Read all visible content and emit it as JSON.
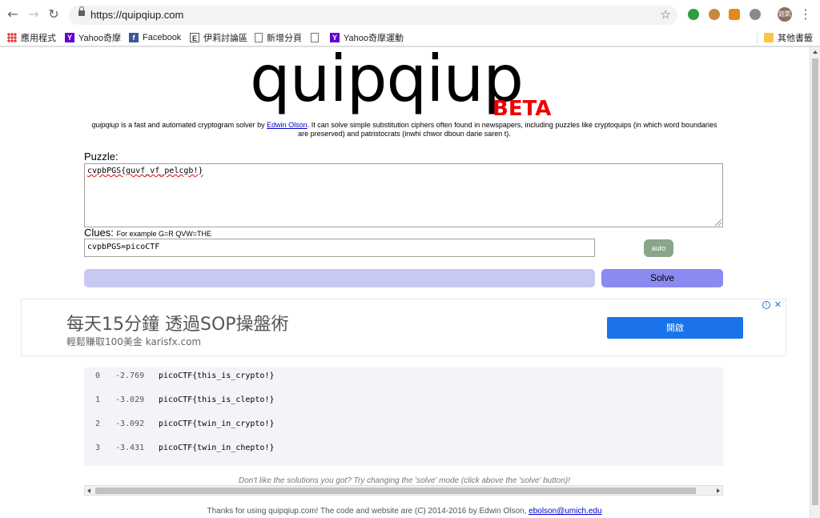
{
  "browser": {
    "url": "https://quipqiup.com",
    "avatar_text": "鈺凱"
  },
  "bookmarks": [
    {
      "label": "應用程式",
      "icon": "apps-icon"
    },
    {
      "label": "Yahoo奇摩",
      "icon": "yahoo-icon"
    },
    {
      "label": "Facebook",
      "icon": "facebook-icon"
    },
    {
      "label": "伊莉討論區",
      "icon": "eyny-icon"
    },
    {
      "label": "新增分頁",
      "icon": "page-icon"
    },
    {
      "label": "Yahoo奇摩運動",
      "icon": "yahoo-icon"
    }
  ],
  "bookmarks_other": "其他書籤",
  "page": {
    "logo": "quipqiup",
    "beta": "BETA",
    "intro_name": "quipqiup",
    "intro_1": " is a fast and automated cryptogram solver by ",
    "intro_author": "Edwin Olson",
    "intro_2": ". It can solve simple substitution ciphers often found in newspapers, including puzzles like cryptoquips (in which word boundaries are preserved) and patristocrats (inwhi chwor dboun darie saren t).",
    "puzzle_label": "Puzzle:",
    "puzzle_value": "cvpbPGS{guvf_vf_pelcgb!}",
    "clues_label": "Clues:",
    "clues_hint": "For example G=R QVW=THE",
    "clues_value": "cvpbPGS=picoCTF",
    "auto_label": "auto",
    "solve_label": "Solve",
    "dont_like": "Don't like the solutions you got? Try changing the 'solve' mode (click above the 'solve' button)!",
    "footer_text": "Thanks for using quipqiup.com! The code and website are (C) 2014-2016 by Edwin Olson, ",
    "footer_email": "ebolson@umich.edu"
  },
  "ad": {
    "headline": "每天15分鐘 透過SOP操盤術",
    "subline": "輕鬆賺取100美金 karisfx.com",
    "button": "開啟",
    "info_icon": "ⓘ",
    "close_icon": "✕"
  },
  "results": [
    {
      "idx": "0",
      "score": "-2.769",
      "text": "picoCTF{this_is_crypto!}"
    },
    {
      "idx": "1",
      "score": "-3.029",
      "text": "picoCTF{this_is_clepto!}"
    },
    {
      "idx": "2",
      "score": "-3.092",
      "text": "picoCTF{twin_in_crypto!}"
    },
    {
      "idx": "3",
      "score": "-3.431",
      "text": "picoCTF{twin_in_chepto!}"
    }
  ],
  "colors": {
    "beta": "#ee0000",
    "solve_button": "#8a8af0",
    "progress": "#c8c8f5",
    "auto_button": "#8aa58a",
    "ad_button": "#1a73e8"
  }
}
